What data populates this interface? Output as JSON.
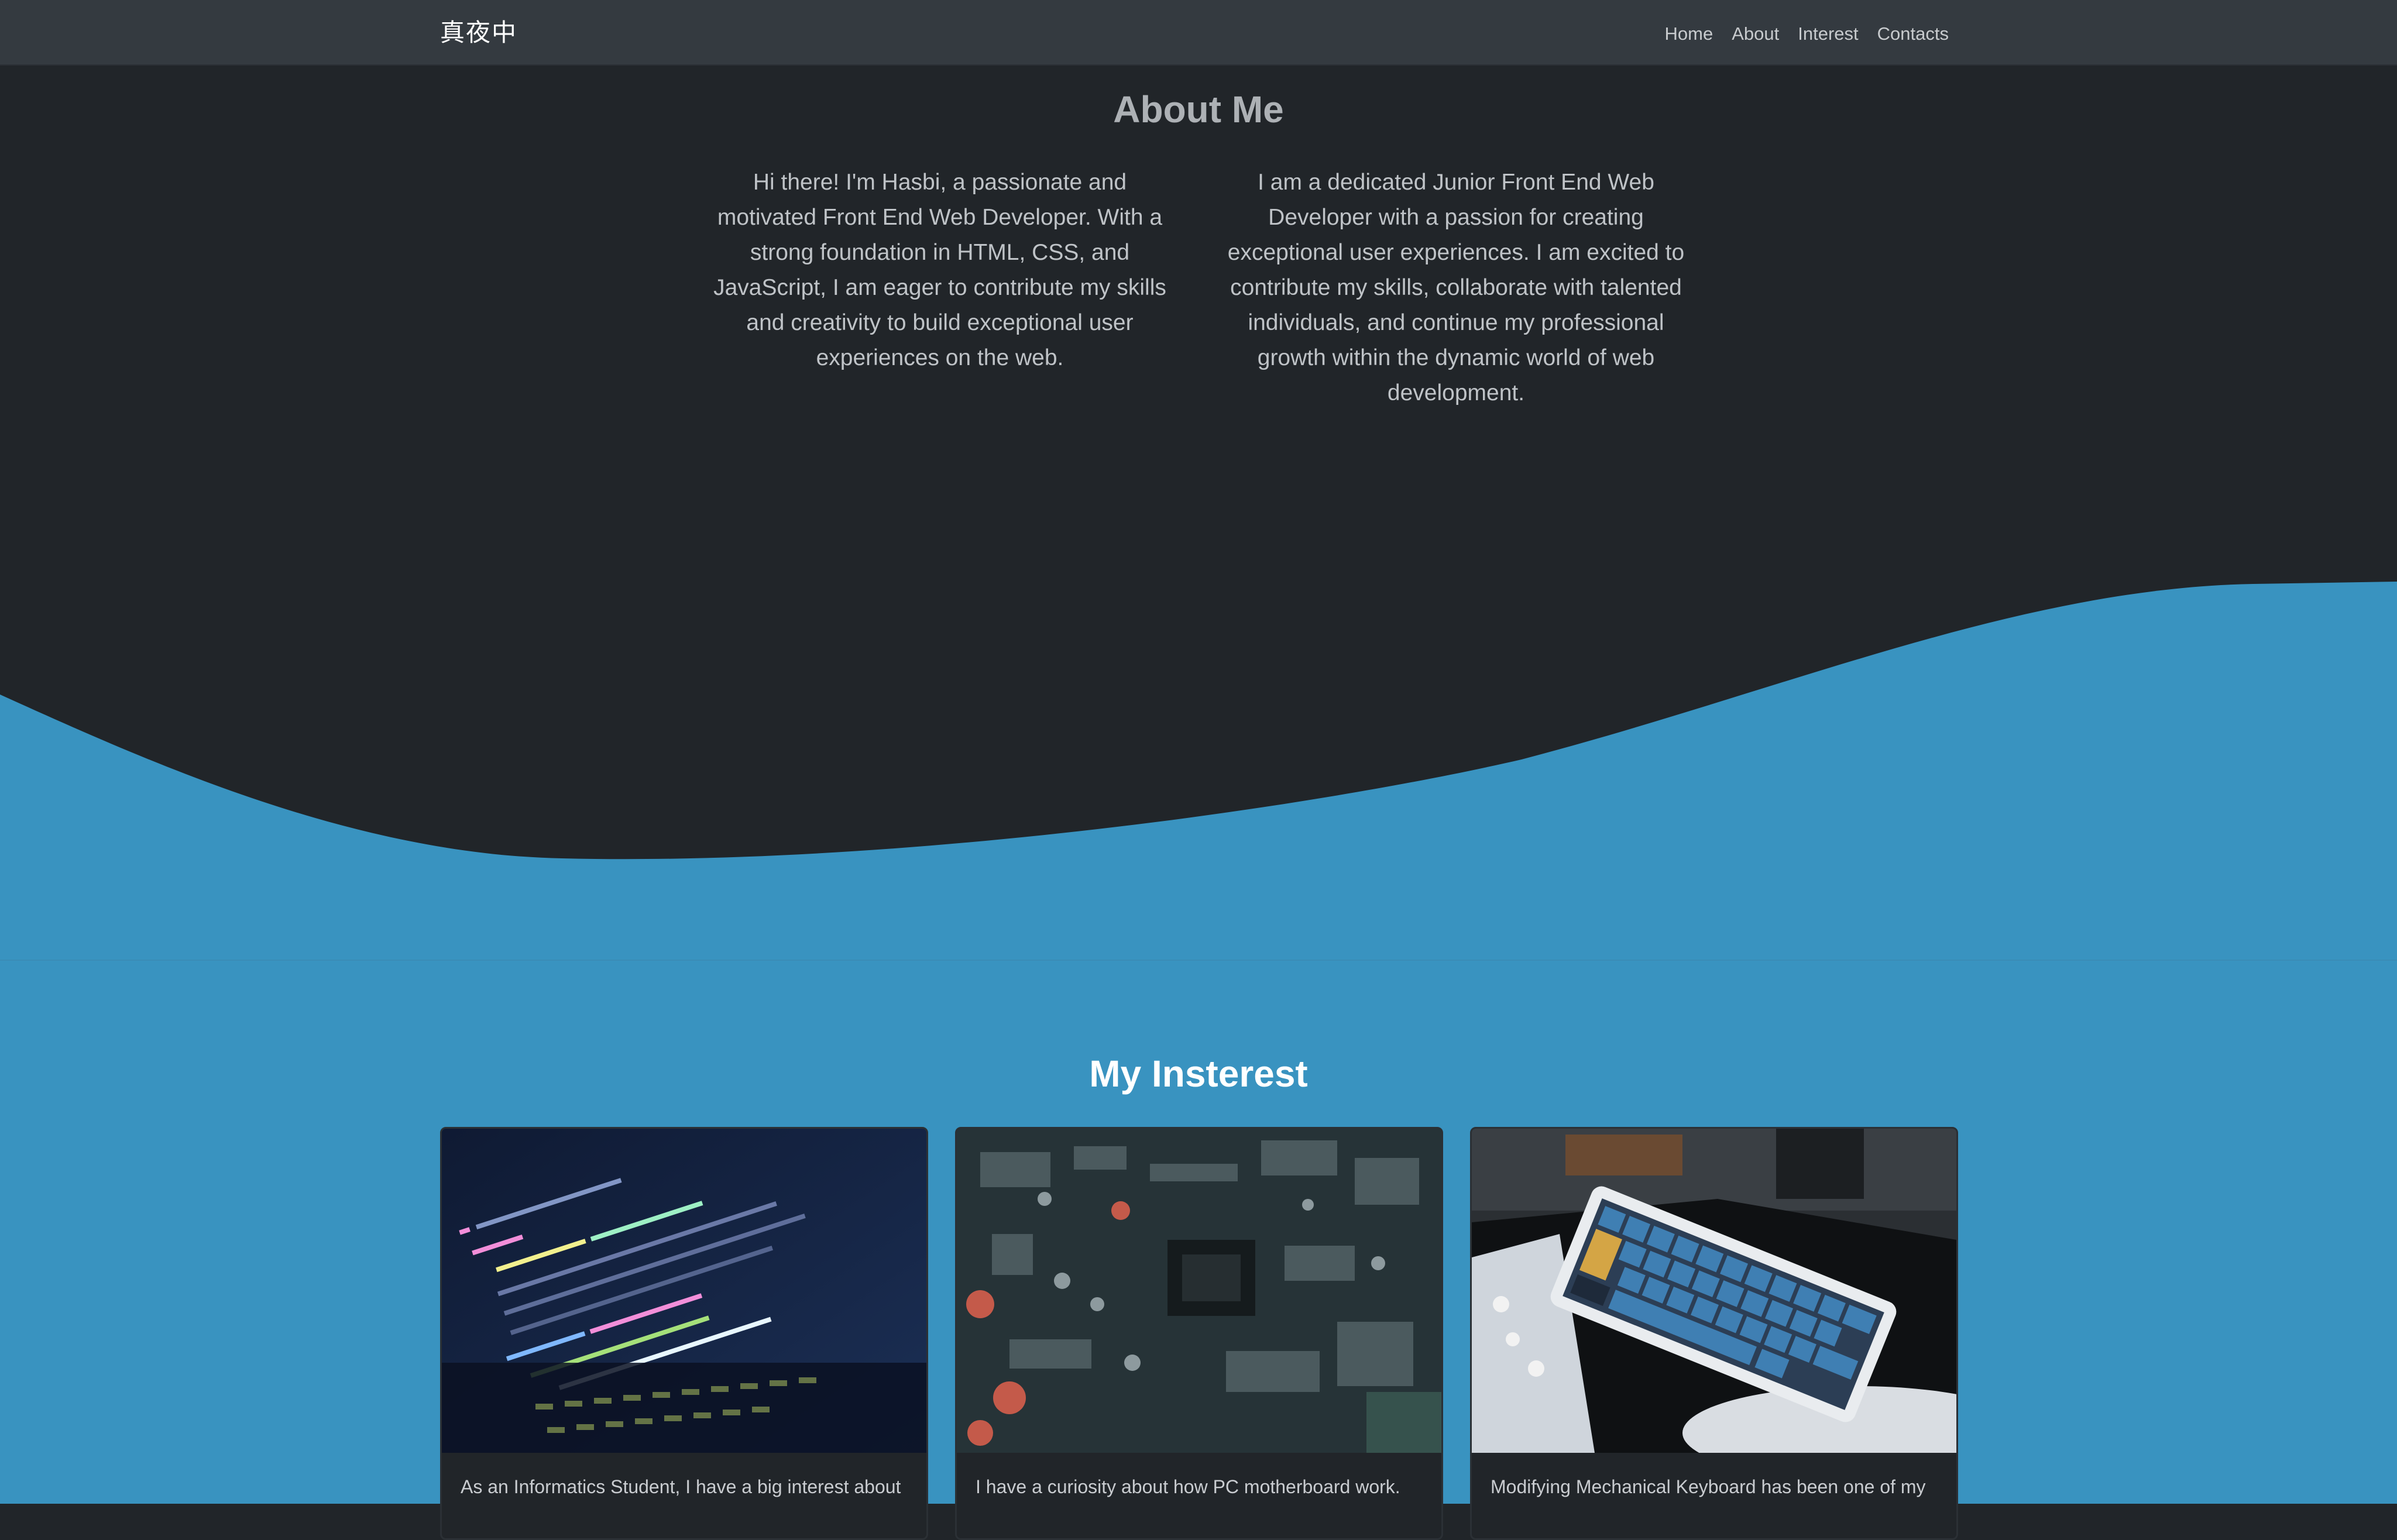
{
  "navbar": {
    "brand": "真夜中",
    "links": [
      "Home",
      "About",
      "Interest",
      "Contacts"
    ]
  },
  "about": {
    "title": "About Me",
    "paragraphs": [
      "Hi there! I'm Hasbi, a passionate and motivated Front End Web Developer. With a strong foundation in HTML, CSS, and JavaScript, I am eager to contribute my skills and creativity to build exceptional user experiences on the web.",
      "I am a dedicated Junior Front End Web Developer with a passion for creating exceptional user experiences. I am excited to contribute my skills, collaborate with talented individuals, and continue my professional growth within the dynamic world of web development."
    ]
  },
  "interest": {
    "title": "My Insterest",
    "cards": [
      {
        "image": "code-on-laptop-photo",
        "text": "As an Informatics Student, I have a big interest about"
      },
      {
        "image": "motherboard-photo",
        "text": "I have a curiosity about how PC motherboard work."
      },
      {
        "image": "mechanical-keyboard-photo",
        "text": "Modifying Mechanical Keyboard has been one of my"
      }
    ]
  },
  "colors": {
    "page_bg": "#212529",
    "navbar_bg": "#343a40",
    "wave_blue": "#3993c0",
    "text_muted": "#adb1b5"
  }
}
